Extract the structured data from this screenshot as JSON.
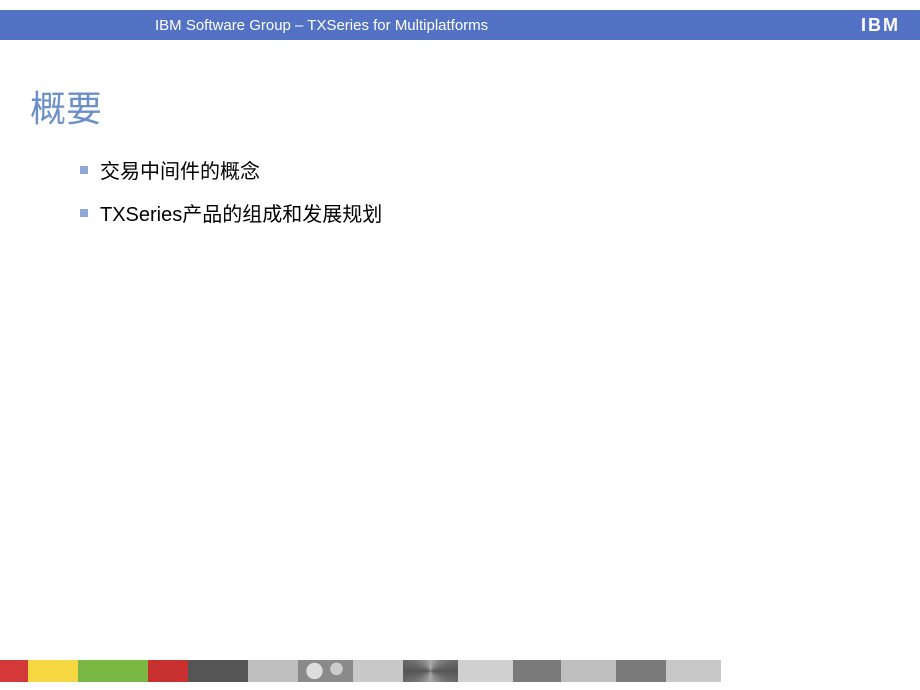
{
  "header": {
    "text": "IBM Software Group – TXSeries for Multiplatforms",
    "logo": "IBM"
  },
  "title": "概要",
  "bullets": [
    "交易中间件的概念",
    "TXSeries产品的组成和发展规划"
  ]
}
